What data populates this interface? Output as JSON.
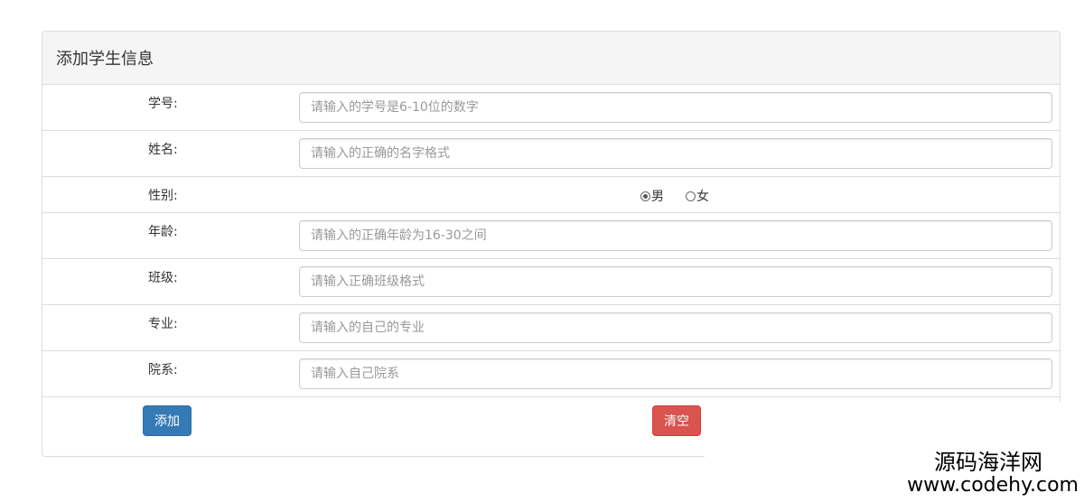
{
  "panel": {
    "title": "添加学生信息"
  },
  "fields": [
    {
      "label": "学号:",
      "placeholder": "请输入的学号是6-10位的数字"
    },
    {
      "label": "姓名:",
      "placeholder": "请输入的正确的名字格式"
    },
    {
      "label": "性别:",
      "options": [
        "男",
        "女"
      ],
      "selected": "男"
    },
    {
      "label": "年龄:",
      "placeholder": "请输入的正确年龄为16-30之间"
    },
    {
      "label": "班级:",
      "placeholder": "请输入正确班级格式"
    },
    {
      "label": "专业:",
      "placeholder": "请输入的自己的专业"
    },
    {
      "label": "院系:",
      "placeholder": "请输入自己院系"
    }
  ],
  "buttons": {
    "add": "添加",
    "clear": "清空"
  },
  "colors": {
    "primary": "#337ab7",
    "danger": "#d9534f",
    "heading_bg": "#f5f5f5",
    "border": "#dddddd"
  },
  "watermark": {
    "line1": "源码海洋网",
    "line2": "www.codehy.com"
  }
}
